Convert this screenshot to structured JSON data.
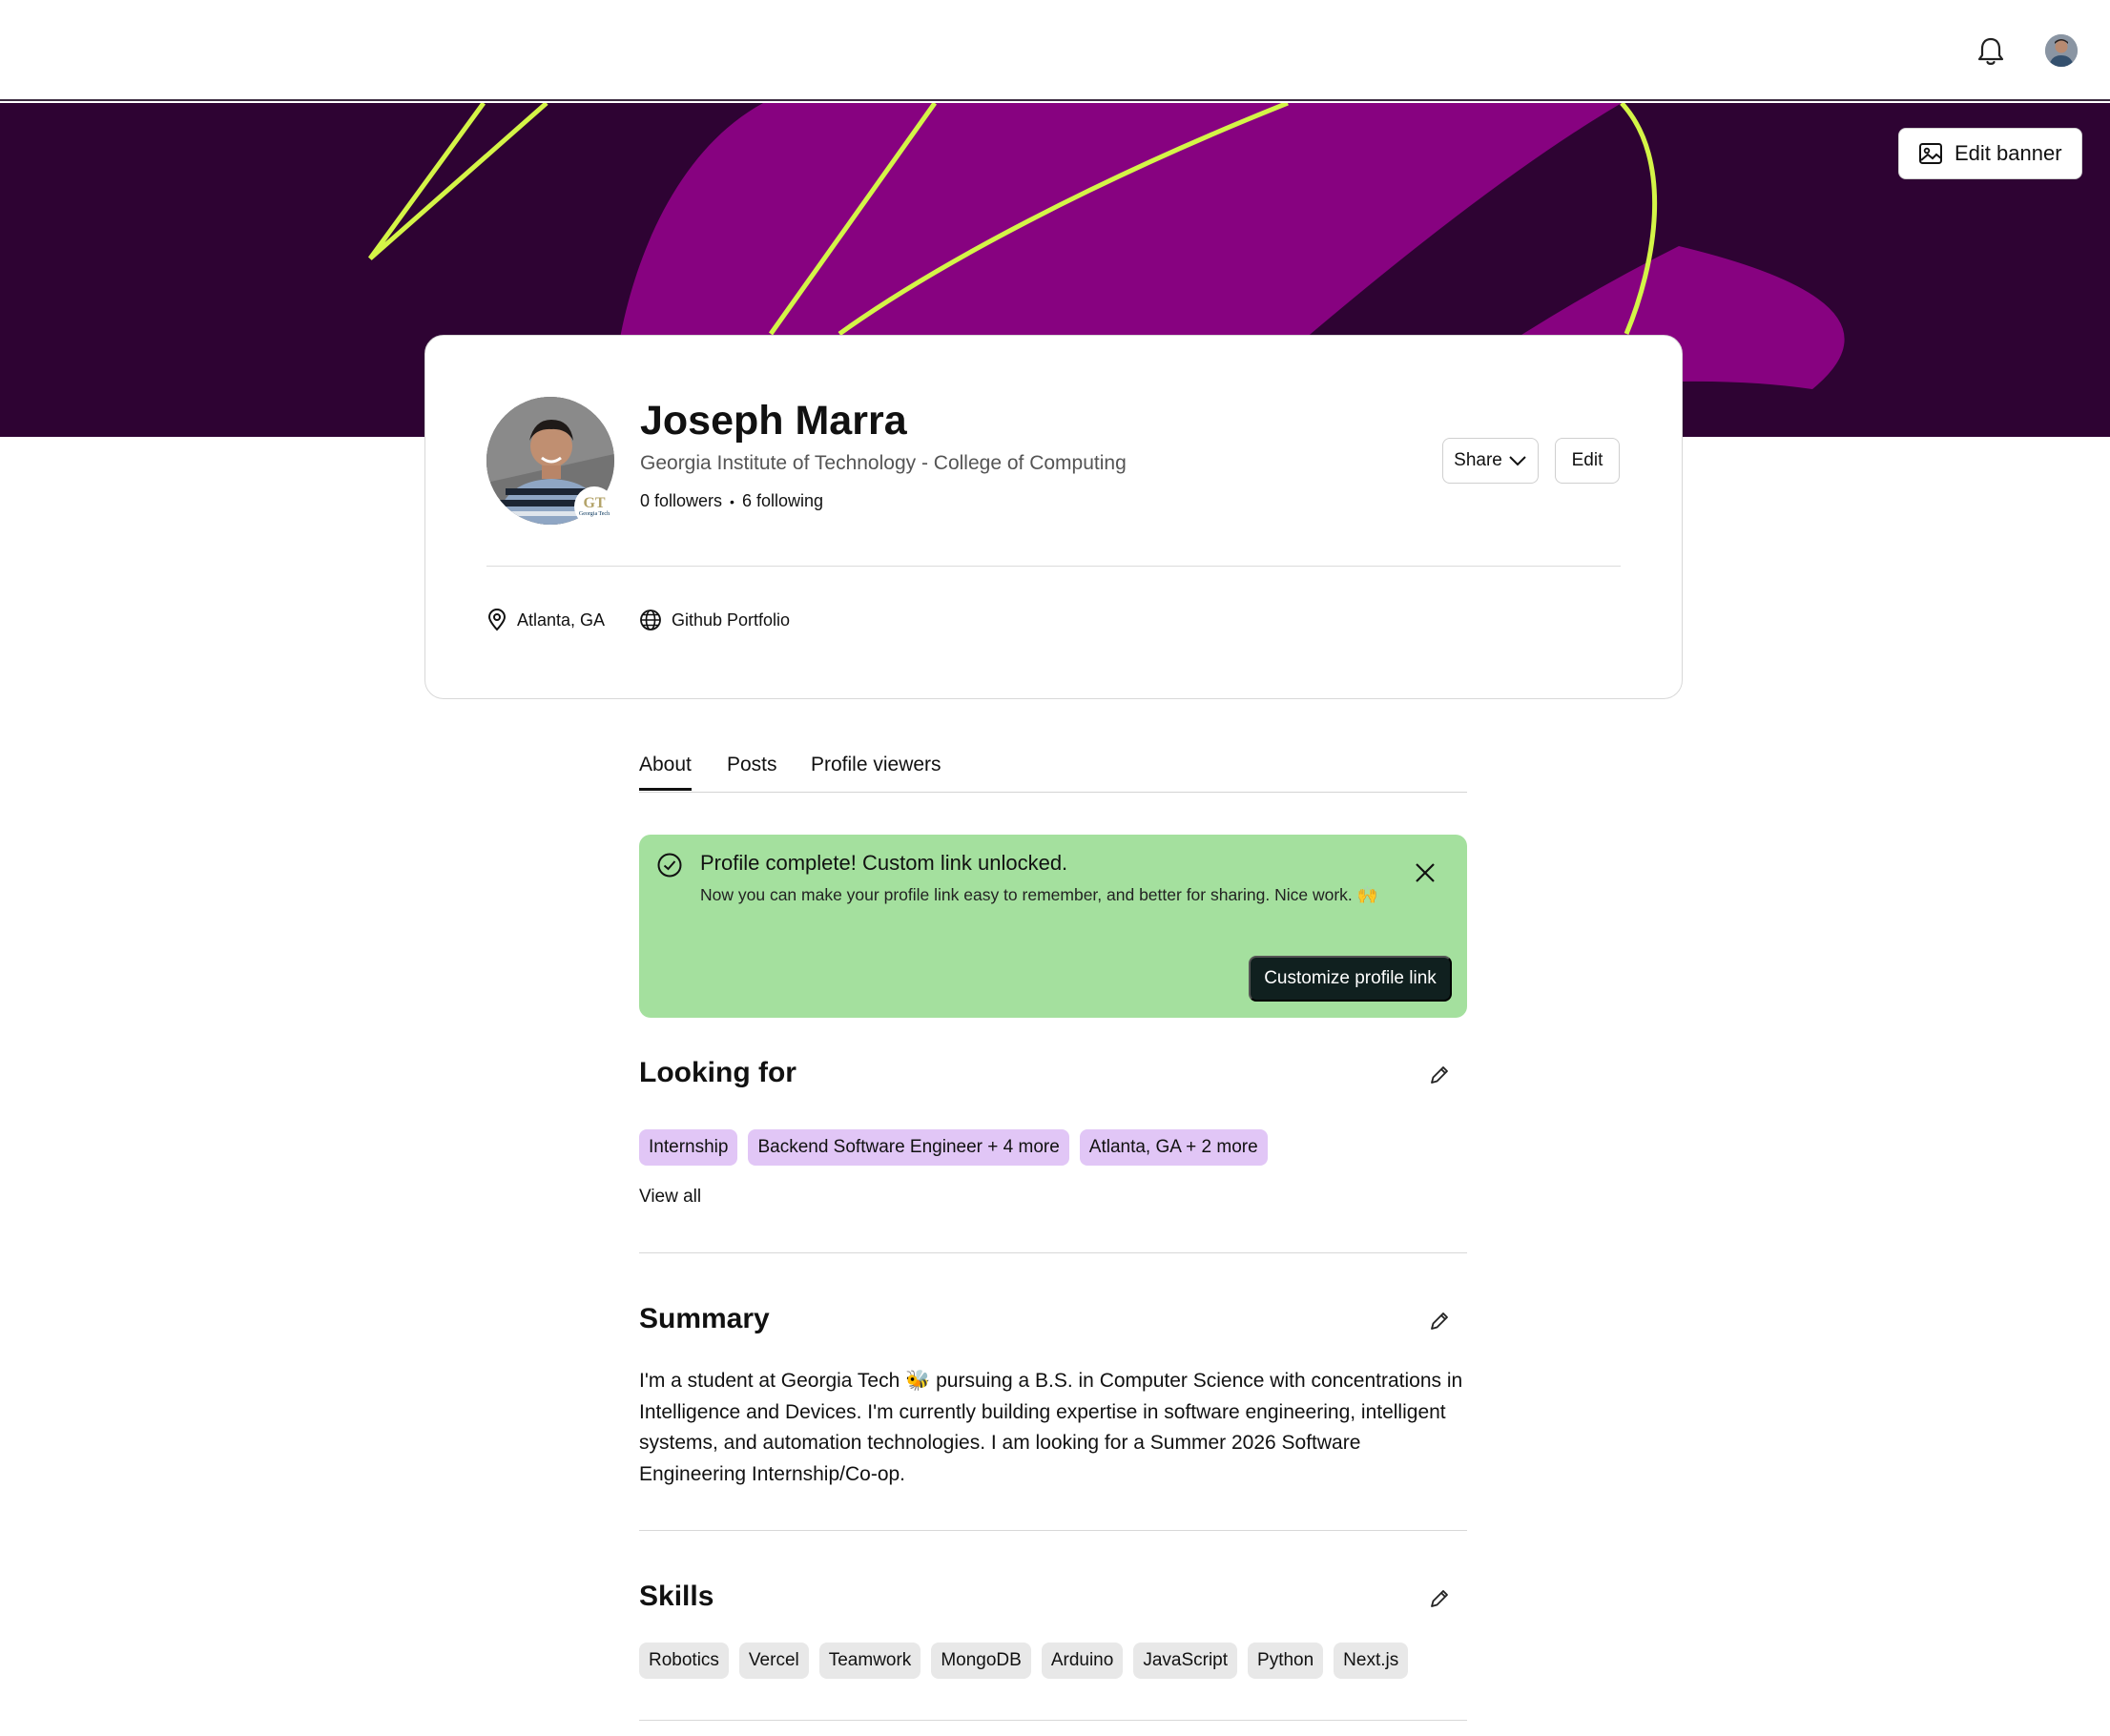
{
  "topbar": {
    "icons": [
      "bell-icon",
      "user-avatar"
    ]
  },
  "banner": {
    "edit_label": "Edit banner",
    "colors": {
      "background": "#2e0333",
      "shape": "#870280",
      "stroke": "#d4f547"
    }
  },
  "profile": {
    "name": "Joseph Marra",
    "school": "Georgia Institute of Technology - College of Computing",
    "followers": "0 followers",
    "separator": "•",
    "following": "6 following",
    "share_label": "Share",
    "edit_label": "Edit",
    "location": "Atlanta, GA",
    "website": "Github Portfolio",
    "school_badge": {
      "logo": "GT",
      "caption": "Georgia Tech"
    }
  },
  "tabs": [
    {
      "label": "About",
      "active": true
    },
    {
      "label": "Posts",
      "active": false
    },
    {
      "label": "Profile viewers",
      "active": false
    }
  ],
  "alert": {
    "title": "Profile complete! Custom link unlocked.",
    "body": "Now you can make your profile link easy to remember, and better for sharing. Nice work. 🙌",
    "cta": "Customize profile link",
    "color": "#a4e09e"
  },
  "looking_for": {
    "title": "Looking for",
    "chips": [
      "Internship",
      "Backend Software Engineer + 4 more",
      "Atlanta, GA + 2 more"
    ],
    "view_all": "View all"
  },
  "summary": {
    "title": "Summary",
    "text": "I'm a student at Georgia Tech 🐝 pursuing a B.S. in Computer Science with concentrations in Intelligence and Devices. I'm currently building expertise in software engineering, intelligent systems, and automation technologies. I am looking for a Summer 2026 Software Engineering Internship/Co-op."
  },
  "skills": {
    "title": "Skills",
    "chips": [
      "Robotics",
      "Vercel",
      "Teamwork",
      "MongoDB",
      "Arduino",
      "JavaScript",
      "Python",
      "Next.js"
    ]
  }
}
